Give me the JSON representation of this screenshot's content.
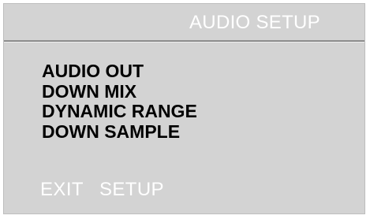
{
  "screen": {
    "title": "AUDIO SETUP"
  },
  "menu": {
    "items": [
      {
        "label": "AUDIO OUT"
      },
      {
        "label": "DOWN MIX"
      },
      {
        "label": "DYNAMIC RANGE"
      },
      {
        "label": "DOWN SAMPLE"
      }
    ]
  },
  "footer": {
    "exit_label": "EXIT",
    "setup_label": "SETUP"
  },
  "colors": {
    "panel_background": "#d3d3d3",
    "title_text": "#ffffff",
    "menu_text": "#000000",
    "footer_text": "#ffffff",
    "divider": "#8c8c8c"
  }
}
